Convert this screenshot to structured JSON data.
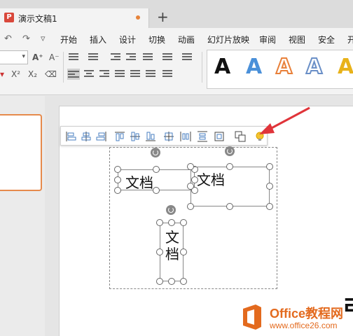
{
  "tab": {
    "app_icon": "P",
    "title": "演示文稿1",
    "new_tab": "+"
  },
  "quick_access": {
    "undo": "↶",
    "redo": "↷",
    "more": "▿"
  },
  "menu": [
    "开始",
    "插入",
    "设计",
    "切换",
    "动画",
    "幻灯片放映",
    "审阅",
    "视图",
    "安全",
    "开"
  ],
  "ribbon": {
    "grow_font": "A⁺",
    "shrink_font": "A⁻",
    "superscript": "X²",
    "subscript": "X₂",
    "clear_format": "⌫"
  },
  "text_styles": {
    "glyph": "A",
    "colors": [
      "#111111",
      "#4a90d9",
      "#e8803a",
      "#6a8fc7",
      "#e8b21a"
    ]
  },
  "slide": {
    "textboxes": [
      {
        "text": "文档"
      },
      {
        "text": "文档"
      },
      {
        "text": "文档"
      }
    ]
  },
  "watermark": {
    "brand": "Office教程网",
    "url": "www.office26.com"
  },
  "corner_char": "ㄹ",
  "colors": {
    "accent": "#e6833a",
    "arrow": "#e0343a",
    "tab_bar": "#dcdcdc"
  }
}
